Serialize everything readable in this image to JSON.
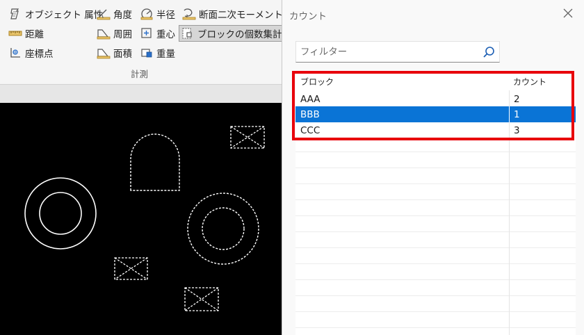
{
  "ribbon": {
    "group_label": "計測",
    "items": [
      {
        "label": "オブジェクト 属性",
        "icon": "object-properties-icon"
      },
      {
        "label": "距離",
        "icon": "distance-icon"
      },
      {
        "label": "座標点",
        "icon": "coordinate-icon"
      },
      {
        "label": "角度",
        "icon": "angle-icon"
      },
      {
        "label": "周囲",
        "icon": "perimeter-icon"
      },
      {
        "label": "面積",
        "icon": "area-icon"
      },
      {
        "label": "半径",
        "icon": "radius-icon"
      },
      {
        "label": "重心",
        "icon": "centroid-icon"
      },
      {
        "label": "重量",
        "icon": "weight-icon"
      },
      {
        "label": "断面二次モーメント",
        "icon": "moment-of-inertia-icon"
      },
      {
        "label": "ブロックの個数集計",
        "icon": "block-count-icon"
      }
    ]
  },
  "panel": {
    "title": "カウント",
    "filter_placeholder": "フィルター",
    "columns": [
      "ブロック",
      "カウント"
    ],
    "rows": [
      {
        "block": "AAA",
        "count": "2"
      },
      {
        "block": "BBB",
        "count": "1"
      },
      {
        "block": "CCC",
        "count": "3"
      }
    ],
    "selected_row": "BBB"
  },
  "colors": {
    "selection": "#0a74d6",
    "highlight_box": "#e8000b",
    "canvas_background": "#000000"
  }
}
